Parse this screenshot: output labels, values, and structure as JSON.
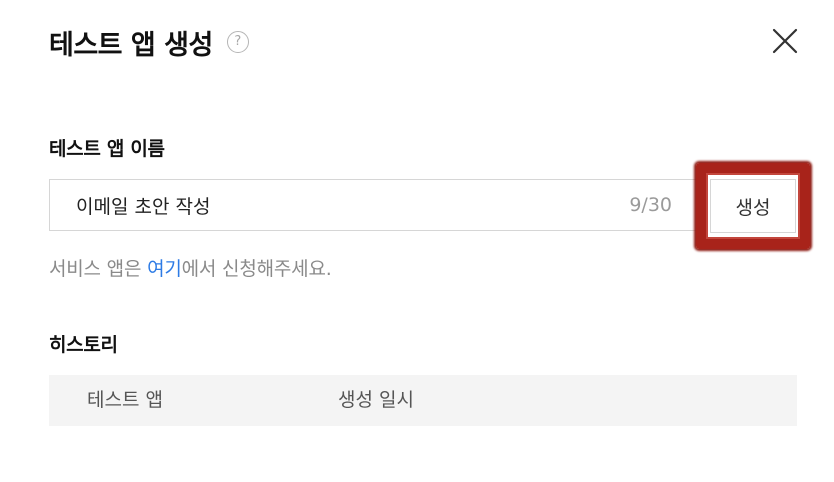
{
  "dialog": {
    "title": "테스트 앱 생성",
    "help_icon": "?",
    "close_icon": "close-icon"
  },
  "name_section": {
    "label": "테스트 앱 이름",
    "input_value": "이메일 초안 작성",
    "counter": "9/30",
    "create_button": "생성"
  },
  "hint": {
    "prefix": "서비스 앱은 ",
    "link": "여기",
    "suffix": "에서 신청해주세요."
  },
  "history": {
    "label": "히스토리",
    "columns": [
      "테스트 앱",
      "생성 일시"
    ]
  },
  "colors": {
    "link": "#2d7be5",
    "highlight_border": "#a8231a"
  }
}
